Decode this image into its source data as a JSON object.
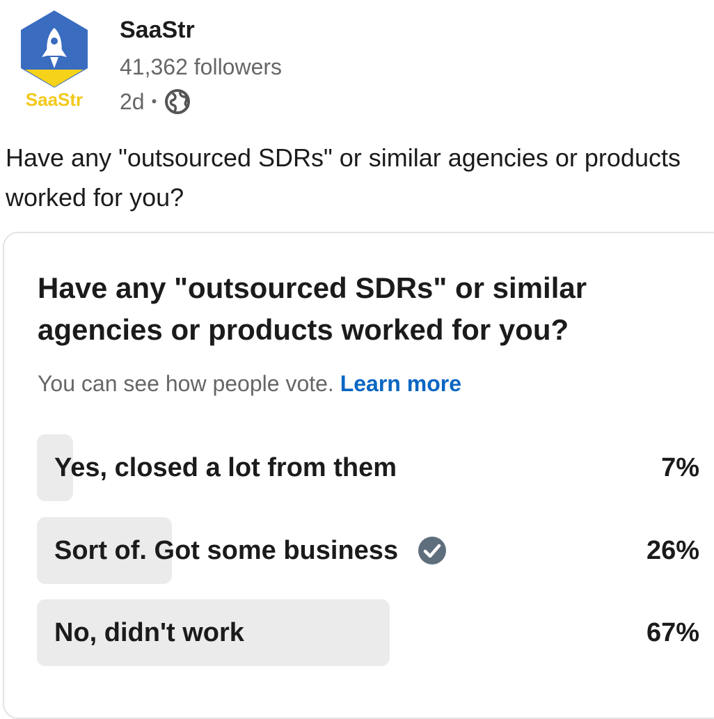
{
  "author": {
    "logo_text": "SaaStr",
    "name": "SaaStr",
    "followers": "41,362 followers",
    "time": "2d",
    "visibility_icon": "globe-icon"
  },
  "post": {
    "text": "Have any \"outsourced SDRs\" or similar agencies or products worked for you?"
  },
  "poll": {
    "question": "Have any \"outsourced SDRs\" or similar agencies or products worked for you?",
    "visibility_text": "You can see how people vote.",
    "learn_more": "Learn more",
    "options": [
      {
        "label": "Yes, closed a lot from them",
        "percent": "7%",
        "fill_fraction": 0.054,
        "selected": false
      },
      {
        "label": "Sort of. Got some business",
        "percent": "26%",
        "fill_fraction": 0.202,
        "selected": true
      },
      {
        "label": "No, didn't work",
        "percent": "67%",
        "fill_fraction": 0.528,
        "selected": false
      }
    ]
  },
  "colors": {
    "link": "#0a66c2",
    "logo_blue": "#3a6cc0",
    "logo_yellow": "#f6d21a",
    "bar_fill": "#ebebeb",
    "check": "#5e6e7d"
  }
}
